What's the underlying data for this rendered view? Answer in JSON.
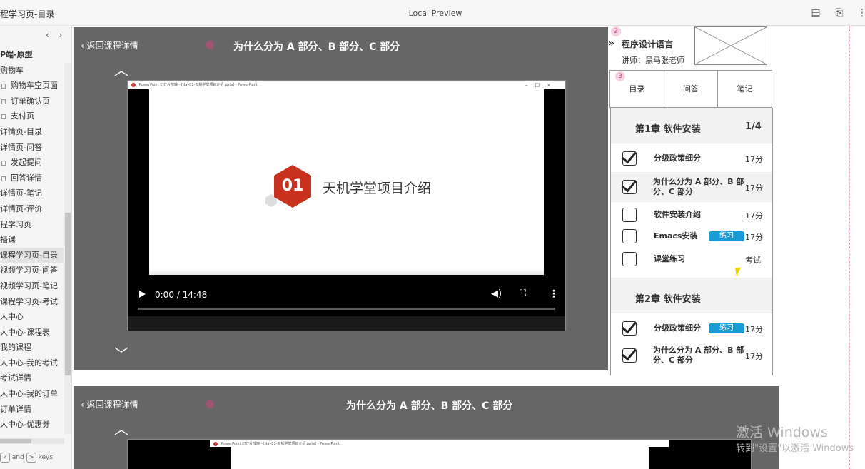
{
  "window": {
    "doc_title": "程学习页-目录",
    "center_title": "Local Preview",
    "icons": [
      "notes-icon",
      "edit-icon",
      "more-icon"
    ]
  },
  "sidebar": {
    "nav_prev": "‹",
    "nav_next": "›",
    "items": [
      {
        "label": "P端-原型",
        "type": "folder"
      },
      {
        "label": "购物车",
        "type": "folder"
      },
      {
        "label": "购物车空页面",
        "type": "page"
      },
      {
        "label": "订单确认页",
        "type": "page"
      },
      {
        "label": "支付页",
        "type": "page"
      },
      {
        "label": "详情页-目录",
        "type": "folder"
      },
      {
        "label": "详情页-问答",
        "type": "folder"
      },
      {
        "label": "发起提问",
        "type": "page"
      },
      {
        "label": "回答详情",
        "type": "page"
      },
      {
        "label": "详情页-笔记",
        "type": "folder"
      },
      {
        "label": "详情页-评价",
        "type": "folder"
      },
      {
        "label": "程学习页",
        "type": "folder"
      },
      {
        "label": "播课",
        "type": "folder"
      },
      {
        "label": "课程学习页-目录",
        "type": "folder",
        "active": true
      },
      {
        "label": "视频学习页-问答",
        "type": "folder"
      },
      {
        "label": "视频学习页-笔记",
        "type": "folder"
      },
      {
        "label": "课程学习页-考试",
        "type": "folder"
      },
      {
        "label": "人中心",
        "type": "folder"
      },
      {
        "label": "人中心-课程表",
        "type": "folder"
      },
      {
        "label": "我的课程",
        "type": "folder"
      },
      {
        "label": "人中心-我的考试",
        "type": "folder"
      },
      {
        "label": "考试详情",
        "type": "folder"
      },
      {
        "label": "人中心-我的订单",
        "type": "folder"
      },
      {
        "label": "订单详情",
        "type": "folder"
      },
      {
        "label": "人中心-优惠券",
        "type": "folder"
      }
    ],
    "footer": {
      "and": "and",
      "key": ">",
      "keys": "keys"
    }
  },
  "player": {
    "back_label": "返回课程详情",
    "title": "为什么分为 A 部分、B 部分、C 部分",
    "ppt_title": "PowerPoint 幻灯片放映 - [day01-天机学堂项目介绍.pptx] - PowerPoint",
    "slide_number": "01",
    "slide_title": "天机学堂项目介绍",
    "time": "0:00 / 14:48",
    "progress": 0
  },
  "course": {
    "name": "程序设计语言",
    "teacher": "讲师：黑马张老师",
    "region_numbers": [
      "2",
      "3"
    ],
    "tabs": [
      "目录",
      "问答",
      "笔记"
    ]
  },
  "catalog": {
    "chapters": [
      {
        "title": "第1章 软件安装",
        "count": "1/4",
        "lessons": [
          {
            "name": "分级政策细分",
            "duration": "17分",
            "checked": true
          },
          {
            "name": "为什么分为 A 部分、B 部分、C 部分",
            "duration": "17分",
            "checked": true,
            "current": true
          },
          {
            "name": "软件安装介绍",
            "duration": "17分",
            "checked": false
          },
          {
            "name": "Emacs安装",
            "duration": "17分",
            "checked": false,
            "badge": "练习"
          },
          {
            "name": "课堂练习",
            "duration": "考试",
            "checked": false
          }
        ]
      },
      {
        "title": "第2章 软件安装",
        "count": "",
        "lessons": [
          {
            "name": "分级政策细分",
            "duration": "17分",
            "checked": true,
            "badge": "练习"
          },
          {
            "name": "为什么分为 A 部分、B 部分、C 部分",
            "duration": "17分",
            "checked": true
          }
        ]
      }
    ]
  },
  "watermark": {
    "line1": "激活 Windows",
    "line2": "转到\"设置\"以激活 Windows"
  }
}
